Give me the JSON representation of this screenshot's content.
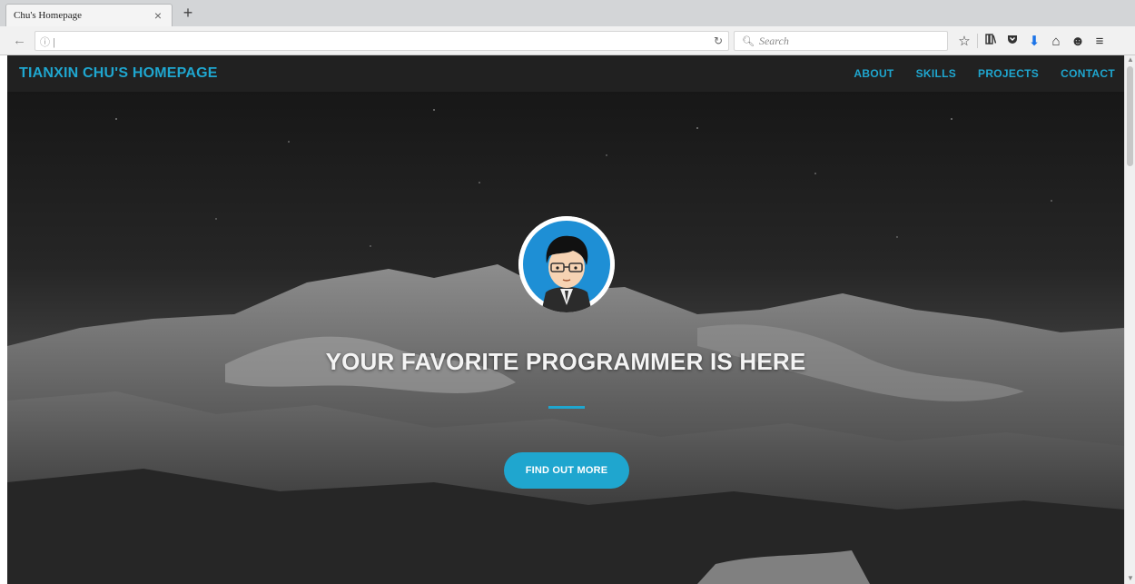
{
  "browser": {
    "tab_title": "Chu's Homepage",
    "tab_close": "×",
    "new_tab": "+",
    "back_icon": "arrow-left-icon",
    "url_info": "ⓘ |",
    "reload": "↻",
    "search_placeholder": "Search",
    "toolbar_icons": [
      "bookmark-star-icon",
      "library-icon",
      "pocket-icon",
      "download-icon",
      "home-icon",
      "emoji-icon",
      "menu-icon"
    ]
  },
  "site": {
    "brand": "TIANXIN CHU'S HOMEPAGE",
    "nav": [
      "ABOUT",
      "SKILLS",
      "PROJECTS",
      "CONTACT"
    ],
    "headline": "YOUR FAVORITE PROGRAMMER IS HERE",
    "cta": "FIND OUT MORE",
    "accent_color": "#1fa6cf"
  }
}
